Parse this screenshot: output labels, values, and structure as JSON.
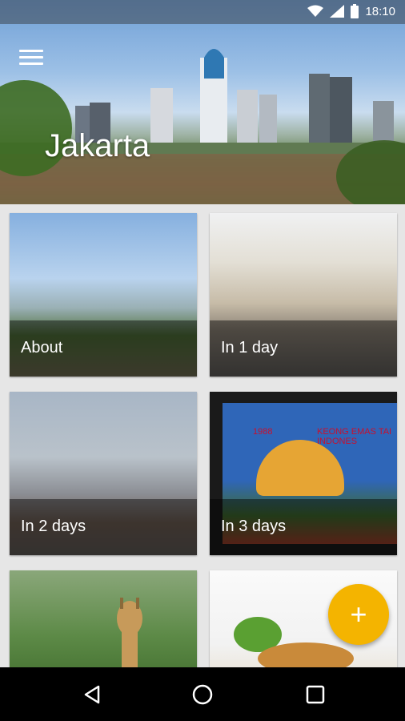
{
  "status_bar": {
    "time": "18:10",
    "icons": [
      "wifi-icon",
      "signal-icon",
      "battery-icon"
    ]
  },
  "header": {
    "title": "Jakarta",
    "menu_icon": "menu-icon"
  },
  "cards": [
    {
      "label": "About"
    },
    {
      "label": "In 1 day"
    },
    {
      "label": "In 2 days"
    },
    {
      "label": "In 3 days"
    },
    {
      "label": ""
    },
    {
      "label": ""
    }
  ],
  "stamp": {
    "year": "1988",
    "caption_top": "KEONG EMAS TAI INDONES"
  },
  "fab": {
    "icon": "plus-icon",
    "color": "#f4b400"
  },
  "nav": {
    "icons": [
      "back-icon",
      "home-icon",
      "recent-apps-icon"
    ]
  }
}
